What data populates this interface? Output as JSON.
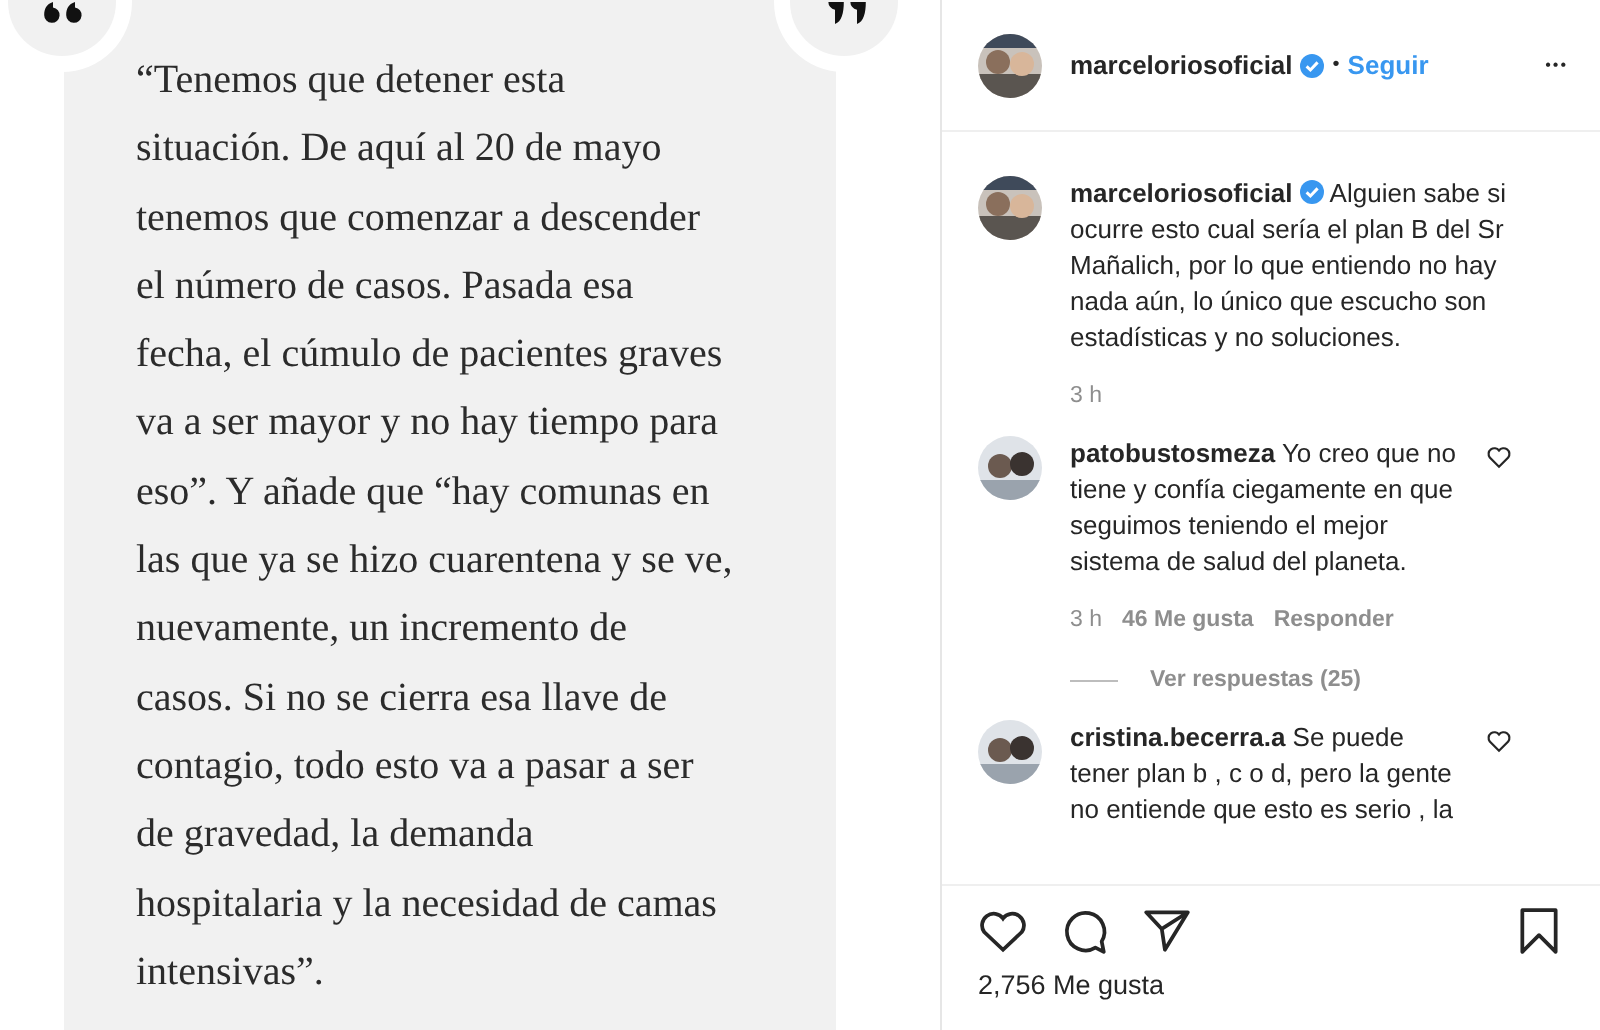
{
  "post_image": {
    "lines": [
      "“Tenemos que detener esta",
      "situación. De aquí al 20 de mayo",
      "tenemos que comenzar a descender",
      "el número de casos. Pasada esa",
      "fecha, el cúmulo de pacientes graves",
      "va a ser mayor y no hay tiempo para",
      "eso”. Y añade que “hay comunas en",
      "las que ya se hizo cuarentena y se ve,",
      "nuevamente, un incremento de",
      "casos. Si no se cierra esa llave de",
      "contagio, todo esto va a pasar a ser",
      "de gravedad, la demanda",
      "hospitalaria y la necesidad de camas",
      "intensivas”."
    ]
  },
  "header": {
    "username": "marceloriosoficial",
    "verified": true,
    "separator": "•",
    "follow": "Seguir",
    "more": "•••"
  },
  "caption": {
    "username": "marceloriosoficial",
    "verified": true,
    "text": "Alguien sabe si ocurre esto cual sería el plan B del Sr Mañalich, por lo que entiendo no hay nada aún, lo único que escucho son estadísticas y no soluciones.",
    "time": "3 h"
  },
  "comments": [
    {
      "username": "patobustosmeza",
      "text": "Yo creo que no tiene y confía ciegamente en que seguimos teniendo el mejor sistema de salud del planeta.",
      "time": "3 h",
      "likes": "46 Me gusta",
      "reply": "Responder",
      "replies": "Ver respuestas (25)"
    },
    {
      "username": "cristina.becerra.a",
      "text": "Se puede tener plan b , c o d, pero la gente no entiende que esto es serio , la"
    }
  ],
  "likes": "2,756 Me gusta"
}
